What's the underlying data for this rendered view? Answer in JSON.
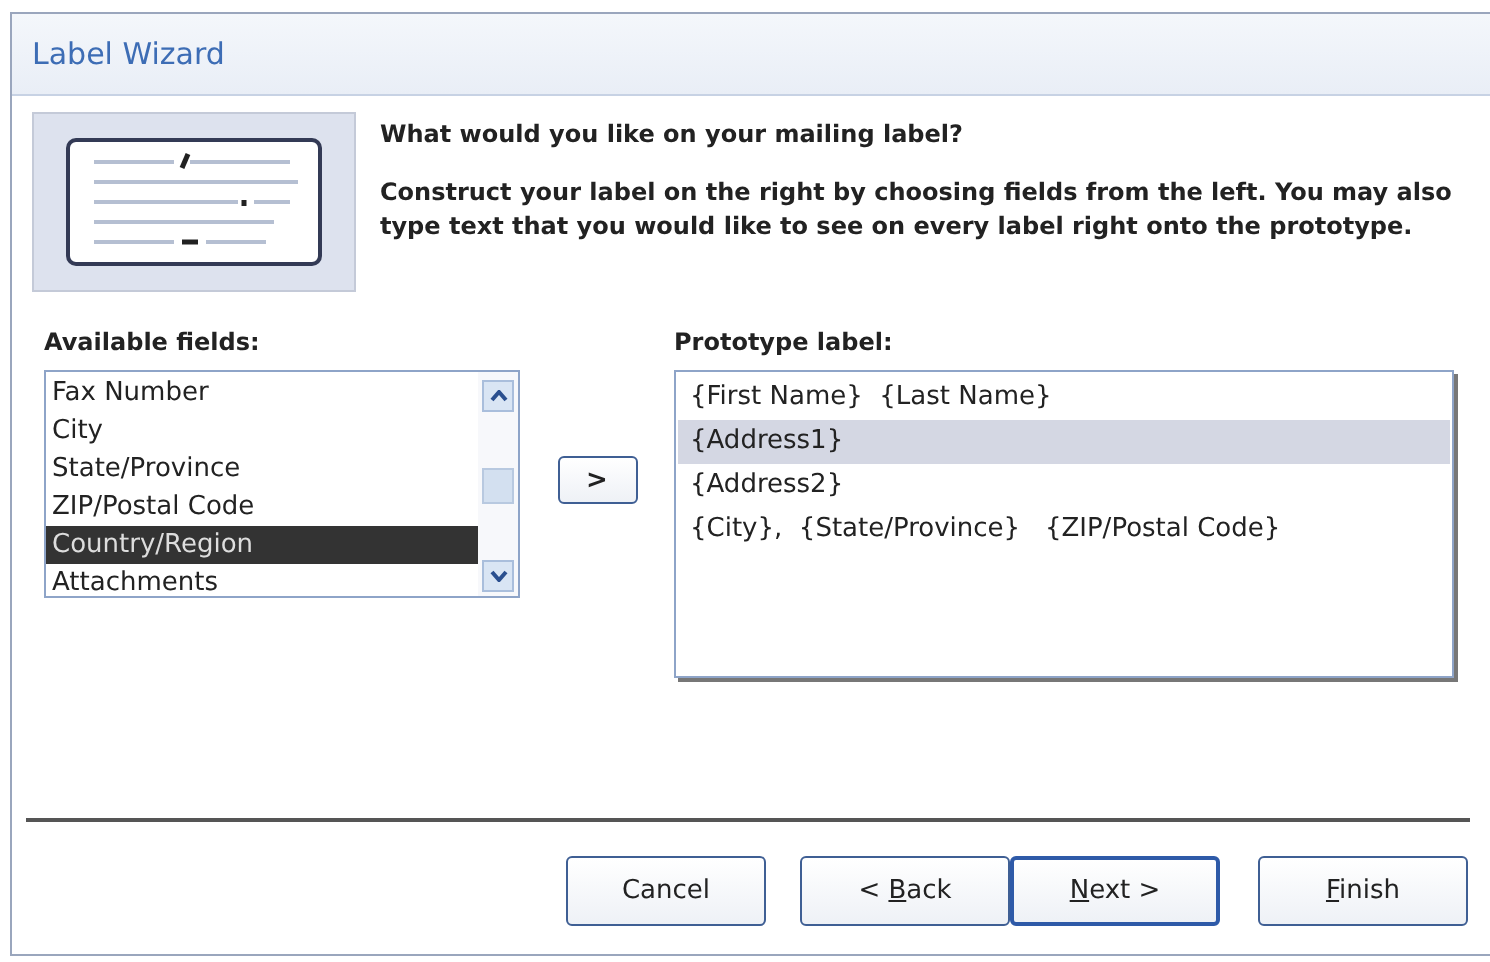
{
  "window": {
    "title": "Label Wizard"
  },
  "header": {
    "question": "What would you like on your mailing label?",
    "instructions": "Construct your label on the right by choosing fields from the left. You may also type text that you would like to see on every label right onto the prototype."
  },
  "available_fields": {
    "label": "Available fields:",
    "items": [
      {
        "text": "Fax Number",
        "selected": false
      },
      {
        "text": "City",
        "selected": false
      },
      {
        "text": "State/Province",
        "selected": false
      },
      {
        "text": "ZIP/Postal Code",
        "selected": false
      },
      {
        "text": "Country/Region",
        "selected": true
      },
      {
        "text": "Attachments",
        "selected": false
      }
    ]
  },
  "add_button": {
    "label": ">"
  },
  "prototype": {
    "label": "Prototype label:",
    "lines": [
      {
        "text": "{First Name}  {Last Name}",
        "selected": false
      },
      {
        "text": "{Address1}",
        "selected": true
      },
      {
        "text": "{Address2}",
        "selected": false
      },
      {
        "text": "{City},  {State/Province}   {ZIP/Postal Code}",
        "selected": false
      }
    ]
  },
  "buttons": [
    {
      "before": "Cancel",
      "default": false
    },
    {
      "before": "< ",
      "key": "B",
      "after": "ack",
      "default": false
    },
    {
      "key": "N",
      "after": "ext >",
      "default": true
    },
    {
      "key": "F",
      "after": "inish",
      "default": false
    }
  ]
}
